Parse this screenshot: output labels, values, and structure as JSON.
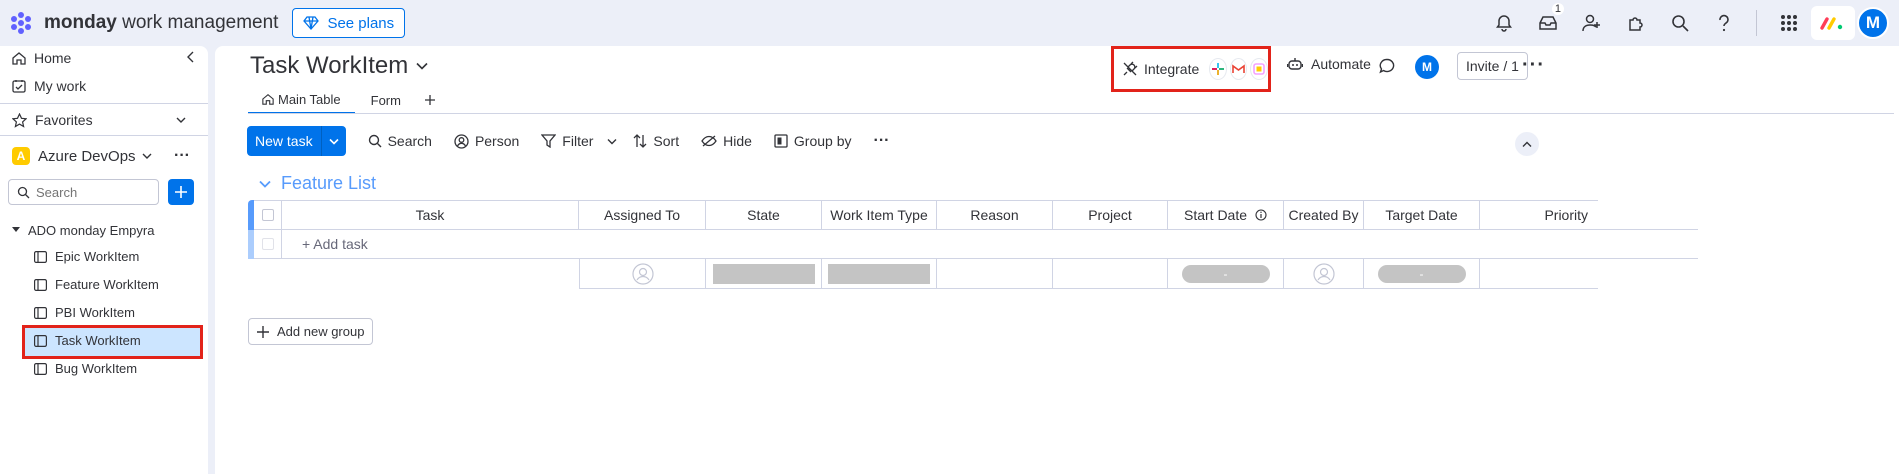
{
  "app": {
    "brand_bold": "monday",
    "brand_rest": "work management",
    "see_plans": "See plans",
    "inbox_badge": "1",
    "avatar_initial": "M"
  },
  "sidebar": {
    "home": "Home",
    "my_work": "My work",
    "favorites": "Favorites",
    "workspace_letter": "A",
    "workspace_name": "Azure DevOps",
    "search_placeholder": "Search",
    "folder": "ADO monday Empyra",
    "boards": [
      {
        "label": "Epic WorkItem"
      },
      {
        "label": "Feature WorkItem"
      },
      {
        "label": "PBI WorkItem"
      },
      {
        "label": "Task WorkItem",
        "selected": true
      },
      {
        "label": "Bug WorkItem"
      }
    ]
  },
  "board": {
    "title": "Task WorkItem",
    "tabs": [
      {
        "label": "Main Table",
        "active": true
      },
      {
        "label": "Form"
      }
    ],
    "integrate": "Integrate",
    "automate": "Automate",
    "avatar_initial": "M",
    "invite": "Invite / 1"
  },
  "toolbar": {
    "new_task": "New task",
    "search": "Search",
    "person": "Person",
    "filter": "Filter",
    "sort": "Sort",
    "hide": "Hide",
    "group_by": "Group by"
  },
  "group": {
    "title": "Feature List",
    "color": "#579bfc",
    "columns": [
      "Task",
      "Assigned To",
      "State",
      "Work Item Type",
      "Reason",
      "Project",
      "Start Date",
      "Created By",
      "Target Date",
      "Priority"
    ],
    "add_task": "+ Add task",
    "summary_dash": "-"
  },
  "add_group": "Add new group"
}
